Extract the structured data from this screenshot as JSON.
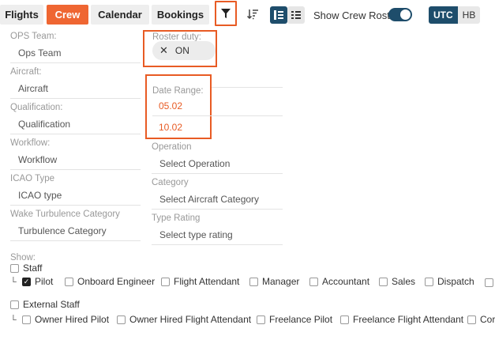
{
  "tabs": [
    {
      "label": "Flights"
    },
    {
      "label": "Crew",
      "active": true
    },
    {
      "label": "Calendar"
    },
    {
      "label": "Bookings"
    }
  ],
  "toolbar": {
    "filter_icon": "filter-icon",
    "sort_icon": "sort-icon",
    "view_list_icon": "list-view-icon",
    "view_detail_icon": "detail-list-icon",
    "show_crew_roster_label": "Show Crew Roster",
    "show_crew_roster_on": true,
    "tz_utc": "UTC",
    "tz_hb": "HB"
  },
  "colors": {
    "accent": "#ef6632",
    "primary": "#1e4d6b",
    "highlight": "#e85b24"
  },
  "filters_left": [
    {
      "label": "OPS Team:",
      "placeholder": "Ops Team"
    },
    {
      "label": "Aircraft:",
      "placeholder": "Aircraft"
    },
    {
      "label": "Qualification:",
      "placeholder": "Qualification"
    },
    {
      "label": "Workflow:",
      "placeholder": "Workflow"
    },
    {
      "label": "ICAO Type",
      "placeholder": "ICAO type"
    },
    {
      "label": "Wake Turbulence Category",
      "placeholder": "Turbulence Category"
    }
  ],
  "roster_duty": {
    "label": "Roster duty:",
    "chip": "ON"
  },
  "date_range": {
    "label": "Date Range:",
    "from": "05.02",
    "to": "10.02"
  },
  "filters_right": [
    {
      "label": "Operation",
      "placeholder": "Select Operation"
    },
    {
      "label": "Category",
      "placeholder": "Select Aircraft Category"
    },
    {
      "label": "Type Rating",
      "placeholder": "Select type rating"
    }
  ],
  "show": {
    "label": "Show:",
    "staff": {
      "label": "Staff",
      "checked": false
    },
    "staff_children": [
      {
        "label": "Pilot",
        "checked": true
      },
      {
        "label": "Onboard Engineer",
        "checked": false
      },
      {
        "label": "Flight Attendant",
        "checked": false
      },
      {
        "label": "Manager",
        "checked": false
      },
      {
        "label": "Accountant",
        "checked": false
      },
      {
        "label": "Sales",
        "checked": false
      },
      {
        "label": "Dispatch",
        "checked": false
      }
    ],
    "external": {
      "label": "External Staff",
      "checked": false
    },
    "external_children": [
      {
        "label": "Owner Hired Pilot",
        "checked": false
      },
      {
        "label": "Owner Hired Flight Attendant",
        "checked": false
      },
      {
        "label": "Freelance Pilot",
        "checked": false
      },
      {
        "label": "Freelance Flight Attendant",
        "checked": false
      },
      {
        "label": "Cor",
        "checked": false
      }
    ]
  }
}
